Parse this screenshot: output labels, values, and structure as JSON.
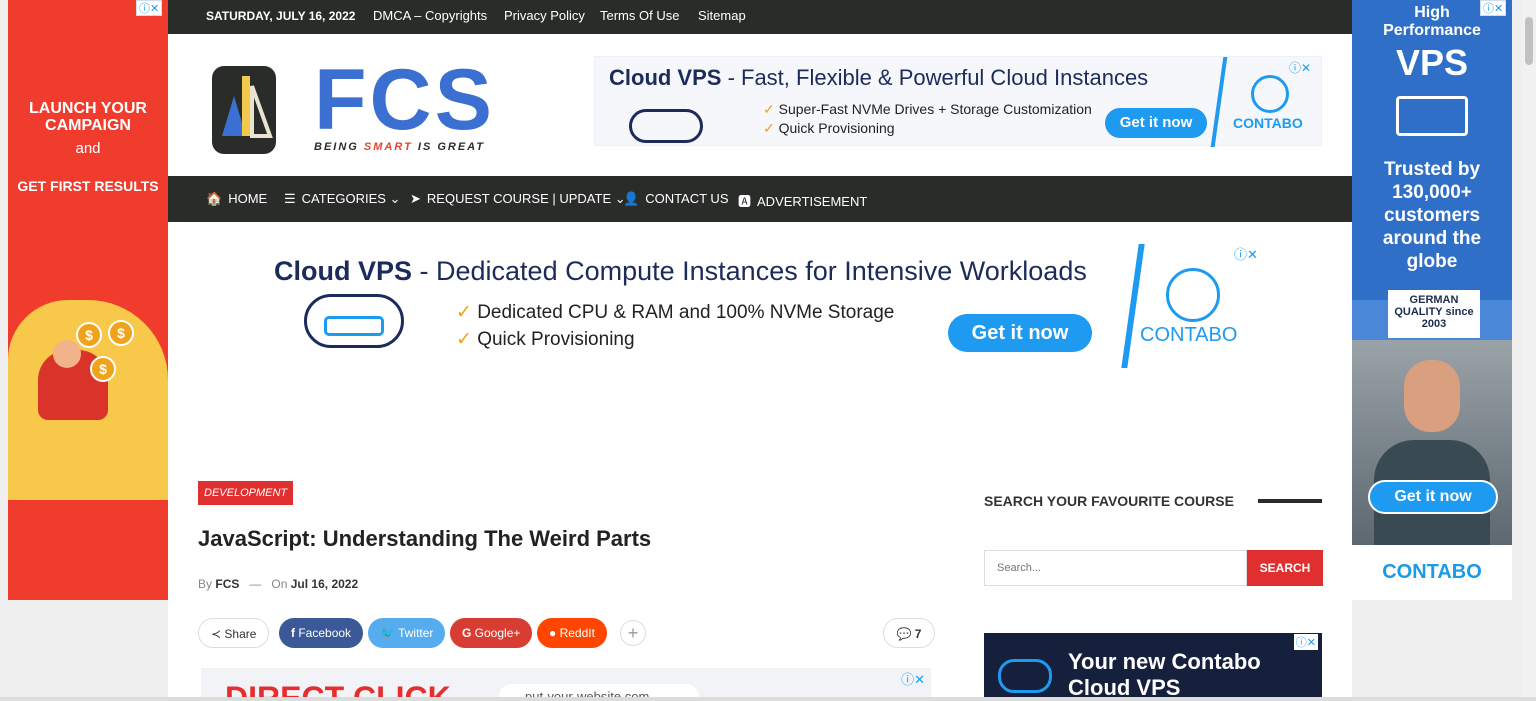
{
  "topbar": {
    "date": "SATURDAY, JULY 16, 2022",
    "links": [
      "DMCA – Copyrights",
      "Privacy Policy",
      "Terms Of Use",
      "Sitemap"
    ]
  },
  "logo": {
    "text": "FCS",
    "tagline_pre": "BEING ",
    "tagline_smart": "SMART",
    "tagline_post": " IS GREAT"
  },
  "ad_left": {
    "line1": "LAUNCH YOUR CAMPAIGN",
    "line2": "and",
    "line3": "GET FIRST RESULTS",
    "adchoice": "ⓘ✕",
    "coin": "$"
  },
  "ad_right": {
    "line1": "High Performance",
    "line2": "VPS",
    "line3": "Trusted by 130,000+ customers around the globe",
    "german": "GERMAN QUALITY since 2003",
    "cta": "Get it now",
    "brand": "CONTABO",
    "adchoice": "ⓘ✕"
  },
  "banner_top": {
    "title_bold": "Cloud VPS",
    "title_rest": " - Fast, Flexible & Powerful Cloud Instances",
    "features": [
      "Super-Fast NVMe Drives + Storage Customization",
      "Quick Provisioning"
    ],
    "cta": "Get it now",
    "brand": "CONTABO",
    "close": "ⓘ✕"
  },
  "nav": {
    "items": [
      {
        "icon": "🏠",
        "label": "HOME"
      },
      {
        "icon": "☰",
        "label": "CATEGORIES ⌄"
      },
      {
        "icon": "➤",
        "label": "REQUEST COURSE | UPDATE ⌄"
      },
      {
        "icon": "👤",
        "label": "CONTACT US"
      },
      {
        "icon": "🅰",
        "label": "ADVERTISEMENT"
      }
    ]
  },
  "banner_mid": {
    "title_bold": "Cloud VPS",
    "title_rest": " - Dedicated Compute Instances for Intensive Workloads",
    "features": [
      "Dedicated CPU & RAM and 100% NVMe Storage",
      "Quick Provisioning"
    ],
    "cta": "Get it now",
    "brand": "CONTABO",
    "close": "ⓘ✕"
  },
  "post": {
    "category": "DEVELOPMENT",
    "title": "JavaScript: Understanding The Weird Parts",
    "by": "By",
    "author": "FCS",
    "sep": "—",
    "on": "On",
    "date": "Jul 16, 2022",
    "share_label": "Share",
    "share_buttons": [
      "Facebook",
      "Twitter",
      "Google+",
      "ReddIt"
    ],
    "more": "+",
    "comment_count": "7"
  },
  "banner_bottom": {
    "headline": "DIRECT CLICK",
    "url": "put-your-website.com",
    "close": "ⓘ✕"
  },
  "sidebar": {
    "heading": "SEARCH YOUR FAVOURITE COURSE",
    "search_placeholder": "Search...",
    "search_button": "SEARCH",
    "ad_title": "Your new Contabo Cloud VPS",
    "ad_close": "ⓘ✕"
  },
  "colors": {
    "nav_bg": "#2a2c2a",
    "accent_red": "#e02f2f",
    "contabo_blue": "#1e9bf0",
    "logo_blue": "#3b6fd1"
  }
}
